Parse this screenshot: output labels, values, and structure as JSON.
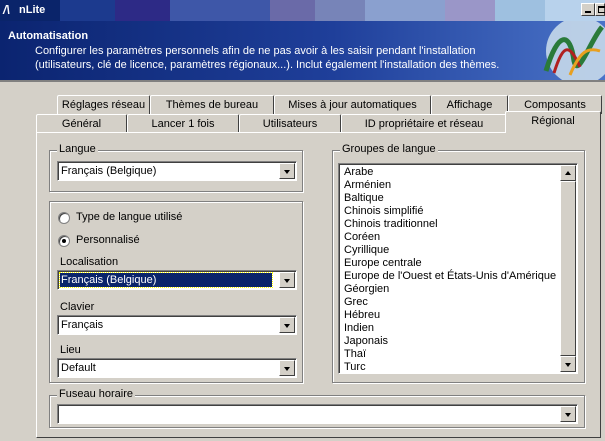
{
  "window": {
    "title": "nLite"
  },
  "header": {
    "title": "Automatisation",
    "desc_line1": "Configurer les paramètres personnels afin de ne pas avoir à les saisir pendant l'installation",
    "desc_line2": "(utilisateurs, clé de licence, paramètres régionaux...). Inclut également l'installation des thèmes."
  },
  "tabs_back": [
    "Réglages réseau",
    "Thèmes de bureau",
    "Mises à jour automatiques",
    "Affichage",
    "Composants"
  ],
  "tabs_front": [
    "Général",
    "Lancer 1 fois",
    "Utilisateurs",
    "ID propriétaire et réseau",
    "Régional"
  ],
  "active_tab": "Régional",
  "language": {
    "group_label": "Langue",
    "value": "Français (Belgique)"
  },
  "settings": {
    "radio_used": "Type de langue utilisé",
    "radio_custom": "Personnalisé",
    "selected_radio": "custom",
    "locale_label": "Localisation",
    "locale_value": "Français (Belgique)",
    "keyboard_label": "Clavier",
    "keyboard_value": "Français",
    "location_label": "Lieu",
    "location_value": "Default"
  },
  "language_groups": {
    "label": "Groupes de langue",
    "items": [
      "Arabe",
      "Arménien",
      "Baltique",
      "Chinois simplifié",
      "Chinois traditionnel",
      "Coréen",
      "Cyrillique",
      "Europe centrale",
      "Europe de l'Ouest et États-Unis d'Amérique",
      "Géorgien",
      "Grec",
      "Hébreu",
      "Indien",
      "Japonais",
      "Thaï",
      "Turc"
    ]
  },
  "timezone": {
    "label": "Fuseau horaire",
    "value": ""
  },
  "icons": {
    "app": "nlite-logo-icon",
    "minimize": "minimize-icon",
    "maximize": "maximize-icon",
    "header_logo": "nlite-banner-logo"
  },
  "colors": {
    "titlebar": "#0a246a",
    "face": "#d4d0c8",
    "selection": "#0a246a"
  }
}
